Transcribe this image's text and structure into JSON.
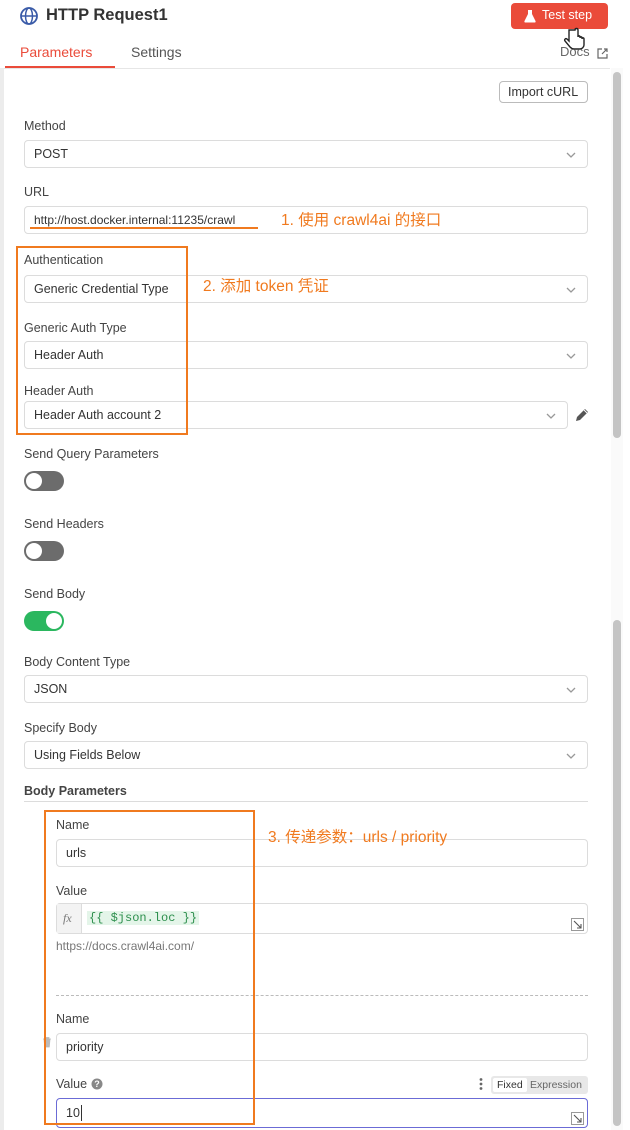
{
  "header": {
    "title": "HTTP Request1",
    "test_step": "Test step",
    "tabs": [
      "Parameters",
      "Settings"
    ],
    "docs": "Docs"
  },
  "toolbar": {
    "import_curl": "Import cURL"
  },
  "form": {
    "method_label": "Method",
    "method_value": "POST",
    "url_label": "URL",
    "url_value": "http://host.docker.internal:11235/crawl",
    "auth_label": "Authentication",
    "auth_value": "Generic Credential Type",
    "generic_auth_label": "Generic Auth Type",
    "generic_auth_value": "Header Auth",
    "header_auth_label": "Header Auth",
    "header_auth_value": "Header Auth account 2",
    "send_query_label": "Send Query Parameters",
    "send_query_on": false,
    "send_headers_label": "Send Headers",
    "send_headers_on": false,
    "send_body_label": "Send Body",
    "send_body_on": true,
    "body_content_type_label": "Body Content Type",
    "body_content_type_value": "JSON",
    "specify_body_label": "Specify Body",
    "specify_body_value": "Using Fields Below",
    "body_params_label": "Body Parameters"
  },
  "params": [
    {
      "name_label": "Name",
      "name_value": "urls",
      "value_label": "Value",
      "fx": "fx",
      "expression": "{{ $json.loc }}",
      "preview": "https://docs.crawl4ai.com/"
    },
    {
      "name_label": "Name",
      "name_value": "priority",
      "value_label": "Value",
      "fixed": "Fixed",
      "expression_tab": "Expression",
      "value": "10"
    }
  ],
  "annotations": [
    "1. 使用 crawl4ai 的接口",
    "2. 添加 token 凭证",
    "3. 传递参数：urls / priority"
  ],
  "colors": {
    "accent": "#ea4b3a",
    "toggle_on": "#2bb75f",
    "toggle_off": "#6c6c6c",
    "annotation": "#f07a1f",
    "expression": "#2d8f4d"
  }
}
